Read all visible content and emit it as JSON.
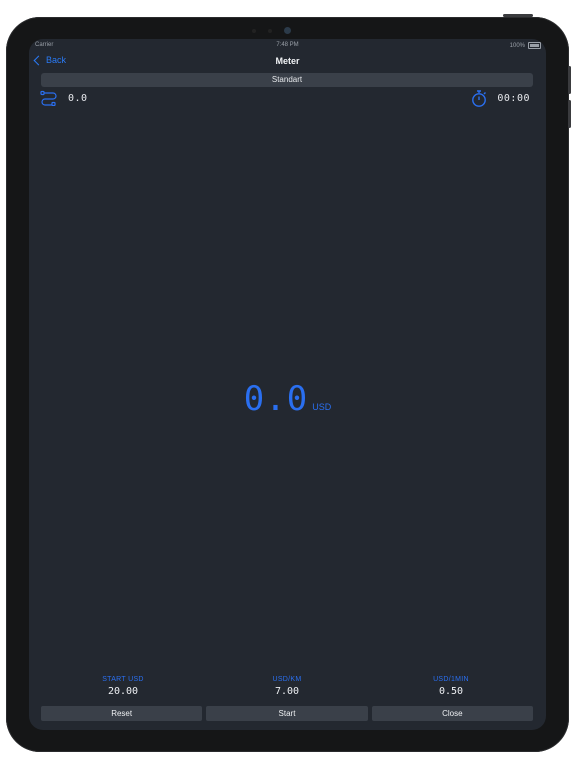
{
  "status_bar": {
    "carrier": "Carrier",
    "time": "7:48 PM",
    "battery": "100%"
  },
  "nav": {
    "back_label": "Back",
    "title": "Meter"
  },
  "segment": {
    "label": "Standart"
  },
  "distance": {
    "value": "0.0",
    "icon": "route-icon"
  },
  "timer": {
    "value": "00:00",
    "icon": "stopwatch-icon"
  },
  "fare": {
    "value": "0.0",
    "unit": "USD"
  },
  "params": [
    {
      "label": "START USD",
      "value": "20.00"
    },
    {
      "label": "USD/KM",
      "value": "7.00"
    },
    {
      "label": "USD/1MIN",
      "value": "0.50"
    }
  ],
  "buttons": {
    "reset": "Reset",
    "start": "Start",
    "close": "Close"
  },
  "colors": {
    "accent": "#2a6ff0",
    "background": "#232830",
    "control": "#3a4049"
  }
}
